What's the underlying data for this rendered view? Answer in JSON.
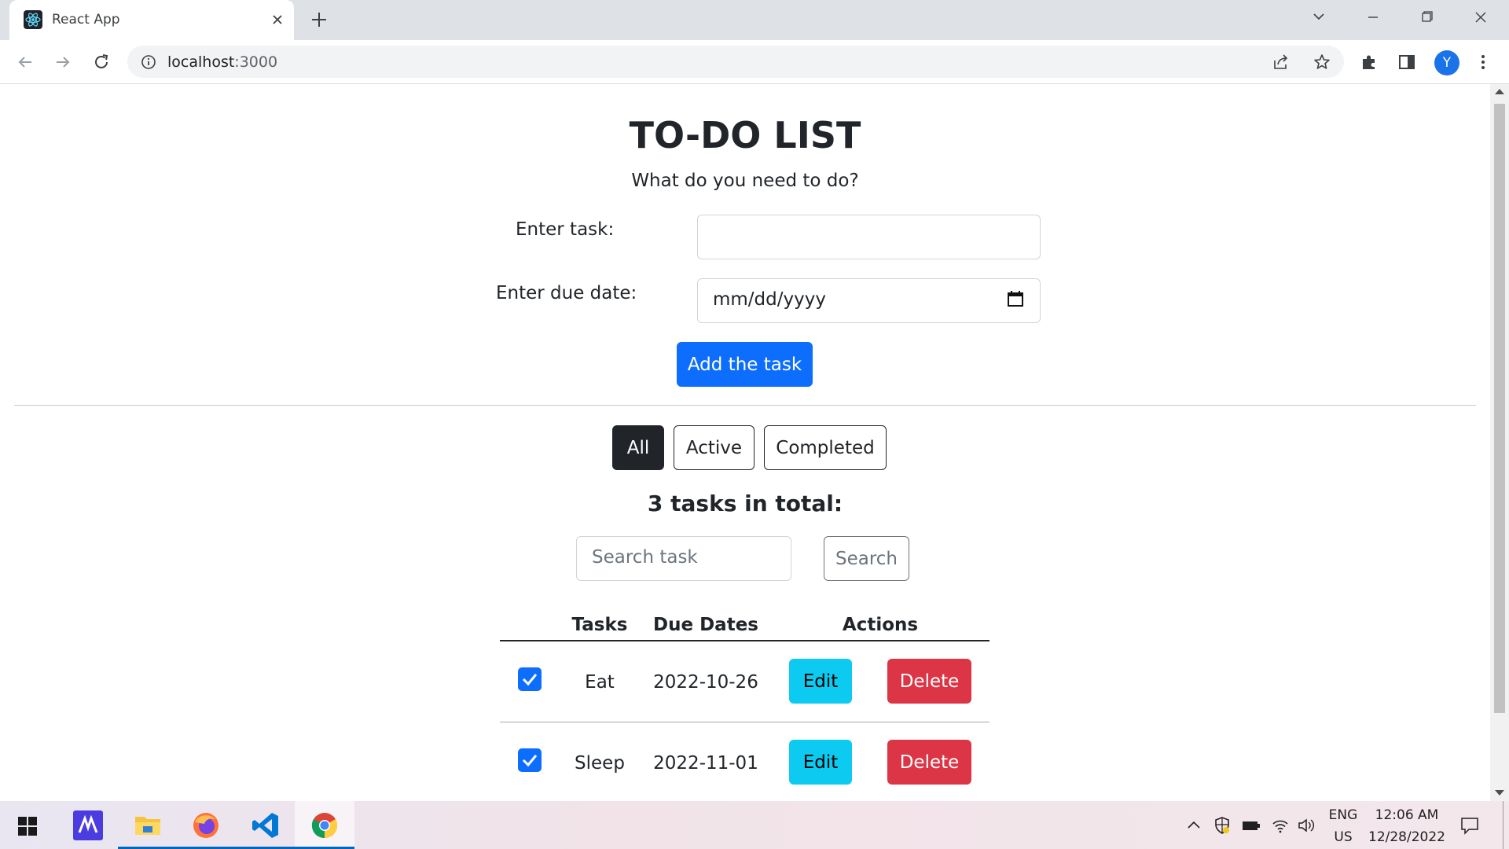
{
  "browser": {
    "tab_title": "React App",
    "url_host": "localhost",
    "url_port": ":3000",
    "avatar_letter": "Y"
  },
  "page": {
    "title": "TO-DO LIST",
    "subtitle": "What do you need to do?",
    "task_label": "Enter task:",
    "task_value": "",
    "date_label": "Enter due date:",
    "date_placeholder": "mm/dd/yyyy",
    "add_button": "Add the task",
    "filters": [
      {
        "label": "All",
        "active": true
      },
      {
        "label": "Active",
        "active": false
      },
      {
        "label": "Completed",
        "active": false
      }
    ],
    "total_text": "3 tasks in total:",
    "search_placeholder": "Search task",
    "search_button": "Search",
    "table": {
      "headers": [
        "Tasks",
        "Due Dates",
        "Actions"
      ],
      "rows": [
        {
          "checked": true,
          "task": "Eat",
          "due": "2022-10-26",
          "edit": "Edit",
          "delete": "Delete"
        },
        {
          "checked": true,
          "task": "Sleep",
          "due": "2022-11-01",
          "edit": "Edit",
          "delete": "Delete"
        }
      ]
    }
  },
  "taskbar": {
    "lang_top": "ENG",
    "lang_bottom": "US",
    "time": "12:06 AM",
    "date": "12/28/2022"
  },
  "colors": {
    "primary": "#0d6efd",
    "info": "#0dcaf0",
    "danger": "#dc3545",
    "dark": "#212529"
  },
  "icons": [
    "react-logo-icon",
    "close-icon",
    "plus-icon",
    "chevron-down-icon",
    "minimize-icon",
    "restore-icon",
    "back-arrow-icon",
    "forward-arrow-icon",
    "reload-icon",
    "info-icon",
    "share-icon",
    "star-icon",
    "puzzle-icon",
    "side-panel-icon",
    "menu-dots-icon",
    "calendar-icon",
    "checkmark-icon",
    "windows-start-icon",
    "file-explorer-icon",
    "firefox-icon",
    "vscode-icon",
    "chrome-icon",
    "notification-icon"
  ]
}
